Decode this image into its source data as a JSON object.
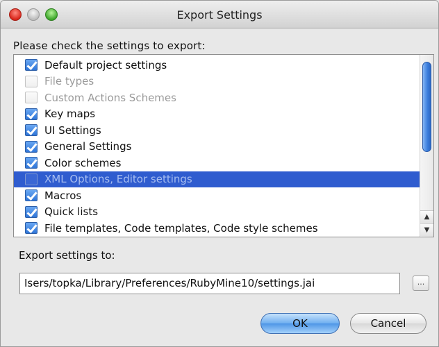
{
  "window": {
    "title": "Export Settings"
  },
  "heading": "Please check the settings to export:",
  "settings_list": {
    "items": [
      {
        "label": "Default project settings",
        "checked": true,
        "disabled": false,
        "selected": false
      },
      {
        "label": "File types",
        "checked": false,
        "disabled": true,
        "selected": false
      },
      {
        "label": "Custom Actions Schemes",
        "checked": false,
        "disabled": true,
        "selected": false
      },
      {
        "label": "Key maps",
        "checked": true,
        "disabled": false,
        "selected": false
      },
      {
        "label": "UI Settings",
        "checked": true,
        "disabled": false,
        "selected": false
      },
      {
        "label": "General Settings",
        "checked": true,
        "disabled": false,
        "selected": false
      },
      {
        "label": "Color schemes",
        "checked": true,
        "disabled": false,
        "selected": false
      },
      {
        "label": "XML Options, Editor settings",
        "checked": false,
        "disabled": true,
        "selected": true
      },
      {
        "label": "Macros",
        "checked": true,
        "disabled": false,
        "selected": false
      },
      {
        "label": "Quick lists",
        "checked": true,
        "disabled": false,
        "selected": false
      },
      {
        "label": "File templates, Code templates, Code style schemes",
        "checked": true,
        "disabled": false,
        "selected": false
      }
    ]
  },
  "export": {
    "label": "Export settings to:",
    "path": "Isers/topka/Library/Preferences/RubyMine10/settings.jai",
    "browse_label": "..."
  },
  "buttons": {
    "ok": "OK",
    "cancel": "Cancel"
  },
  "colors": {
    "selection": "#2f5ccf",
    "accent": "#3a7ddc"
  }
}
